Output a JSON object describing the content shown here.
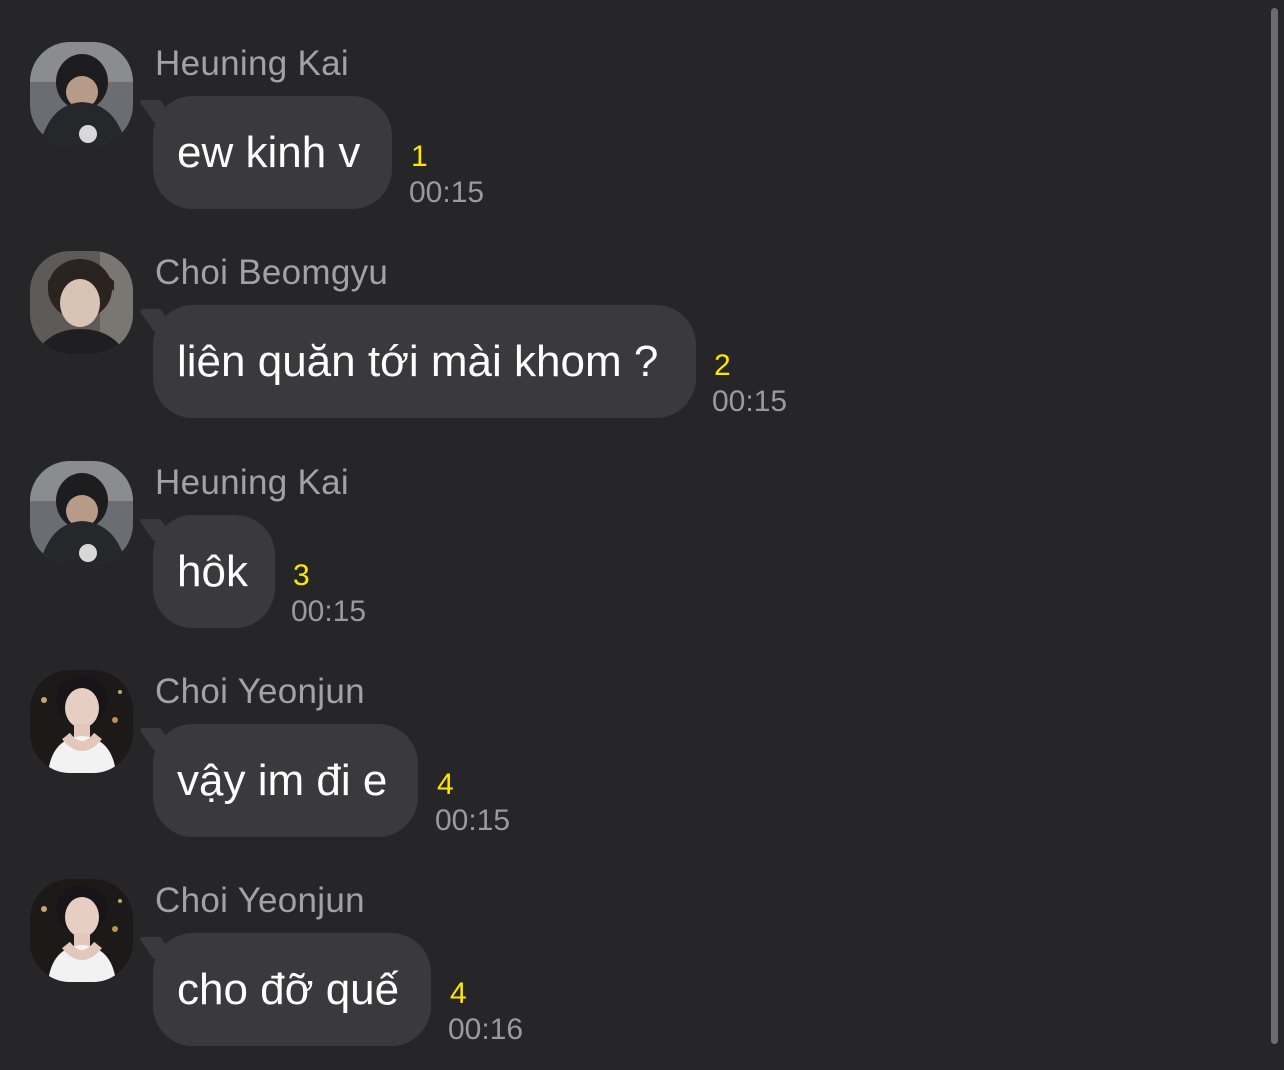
{
  "messages": [
    {
      "sender": "Heuning Kai",
      "text": "ew kinh v",
      "unread": "1",
      "time": "00:15",
      "avatar": "avatar-heuning-kai"
    },
    {
      "sender": "Choi Beomgyu",
      "text": "liên quăn tới mài khom ?",
      "unread": "2",
      "time": "00:15",
      "avatar": "avatar-choi-beomgyu"
    },
    {
      "sender": "Heuning Kai",
      "text": "hôk",
      "unread": "3",
      "time": "00:15",
      "avatar": "avatar-heuning-kai"
    },
    {
      "sender": "Choi Yeonjun",
      "text": "vậy im đi e",
      "unread": "4",
      "time": "00:15",
      "avatar": "avatar-choi-yeonjun"
    },
    {
      "sender": "Choi Yeonjun",
      "text": "cho đỡ quế",
      "unread": "4",
      "time": "00:16",
      "avatar": "avatar-choi-yeonjun"
    }
  ],
  "colors": {
    "background": "#262628",
    "bubble": "#3a3a3c",
    "unread": "#ffe600",
    "sender": "#a2a2a6",
    "time": "#9a9a9e"
  }
}
